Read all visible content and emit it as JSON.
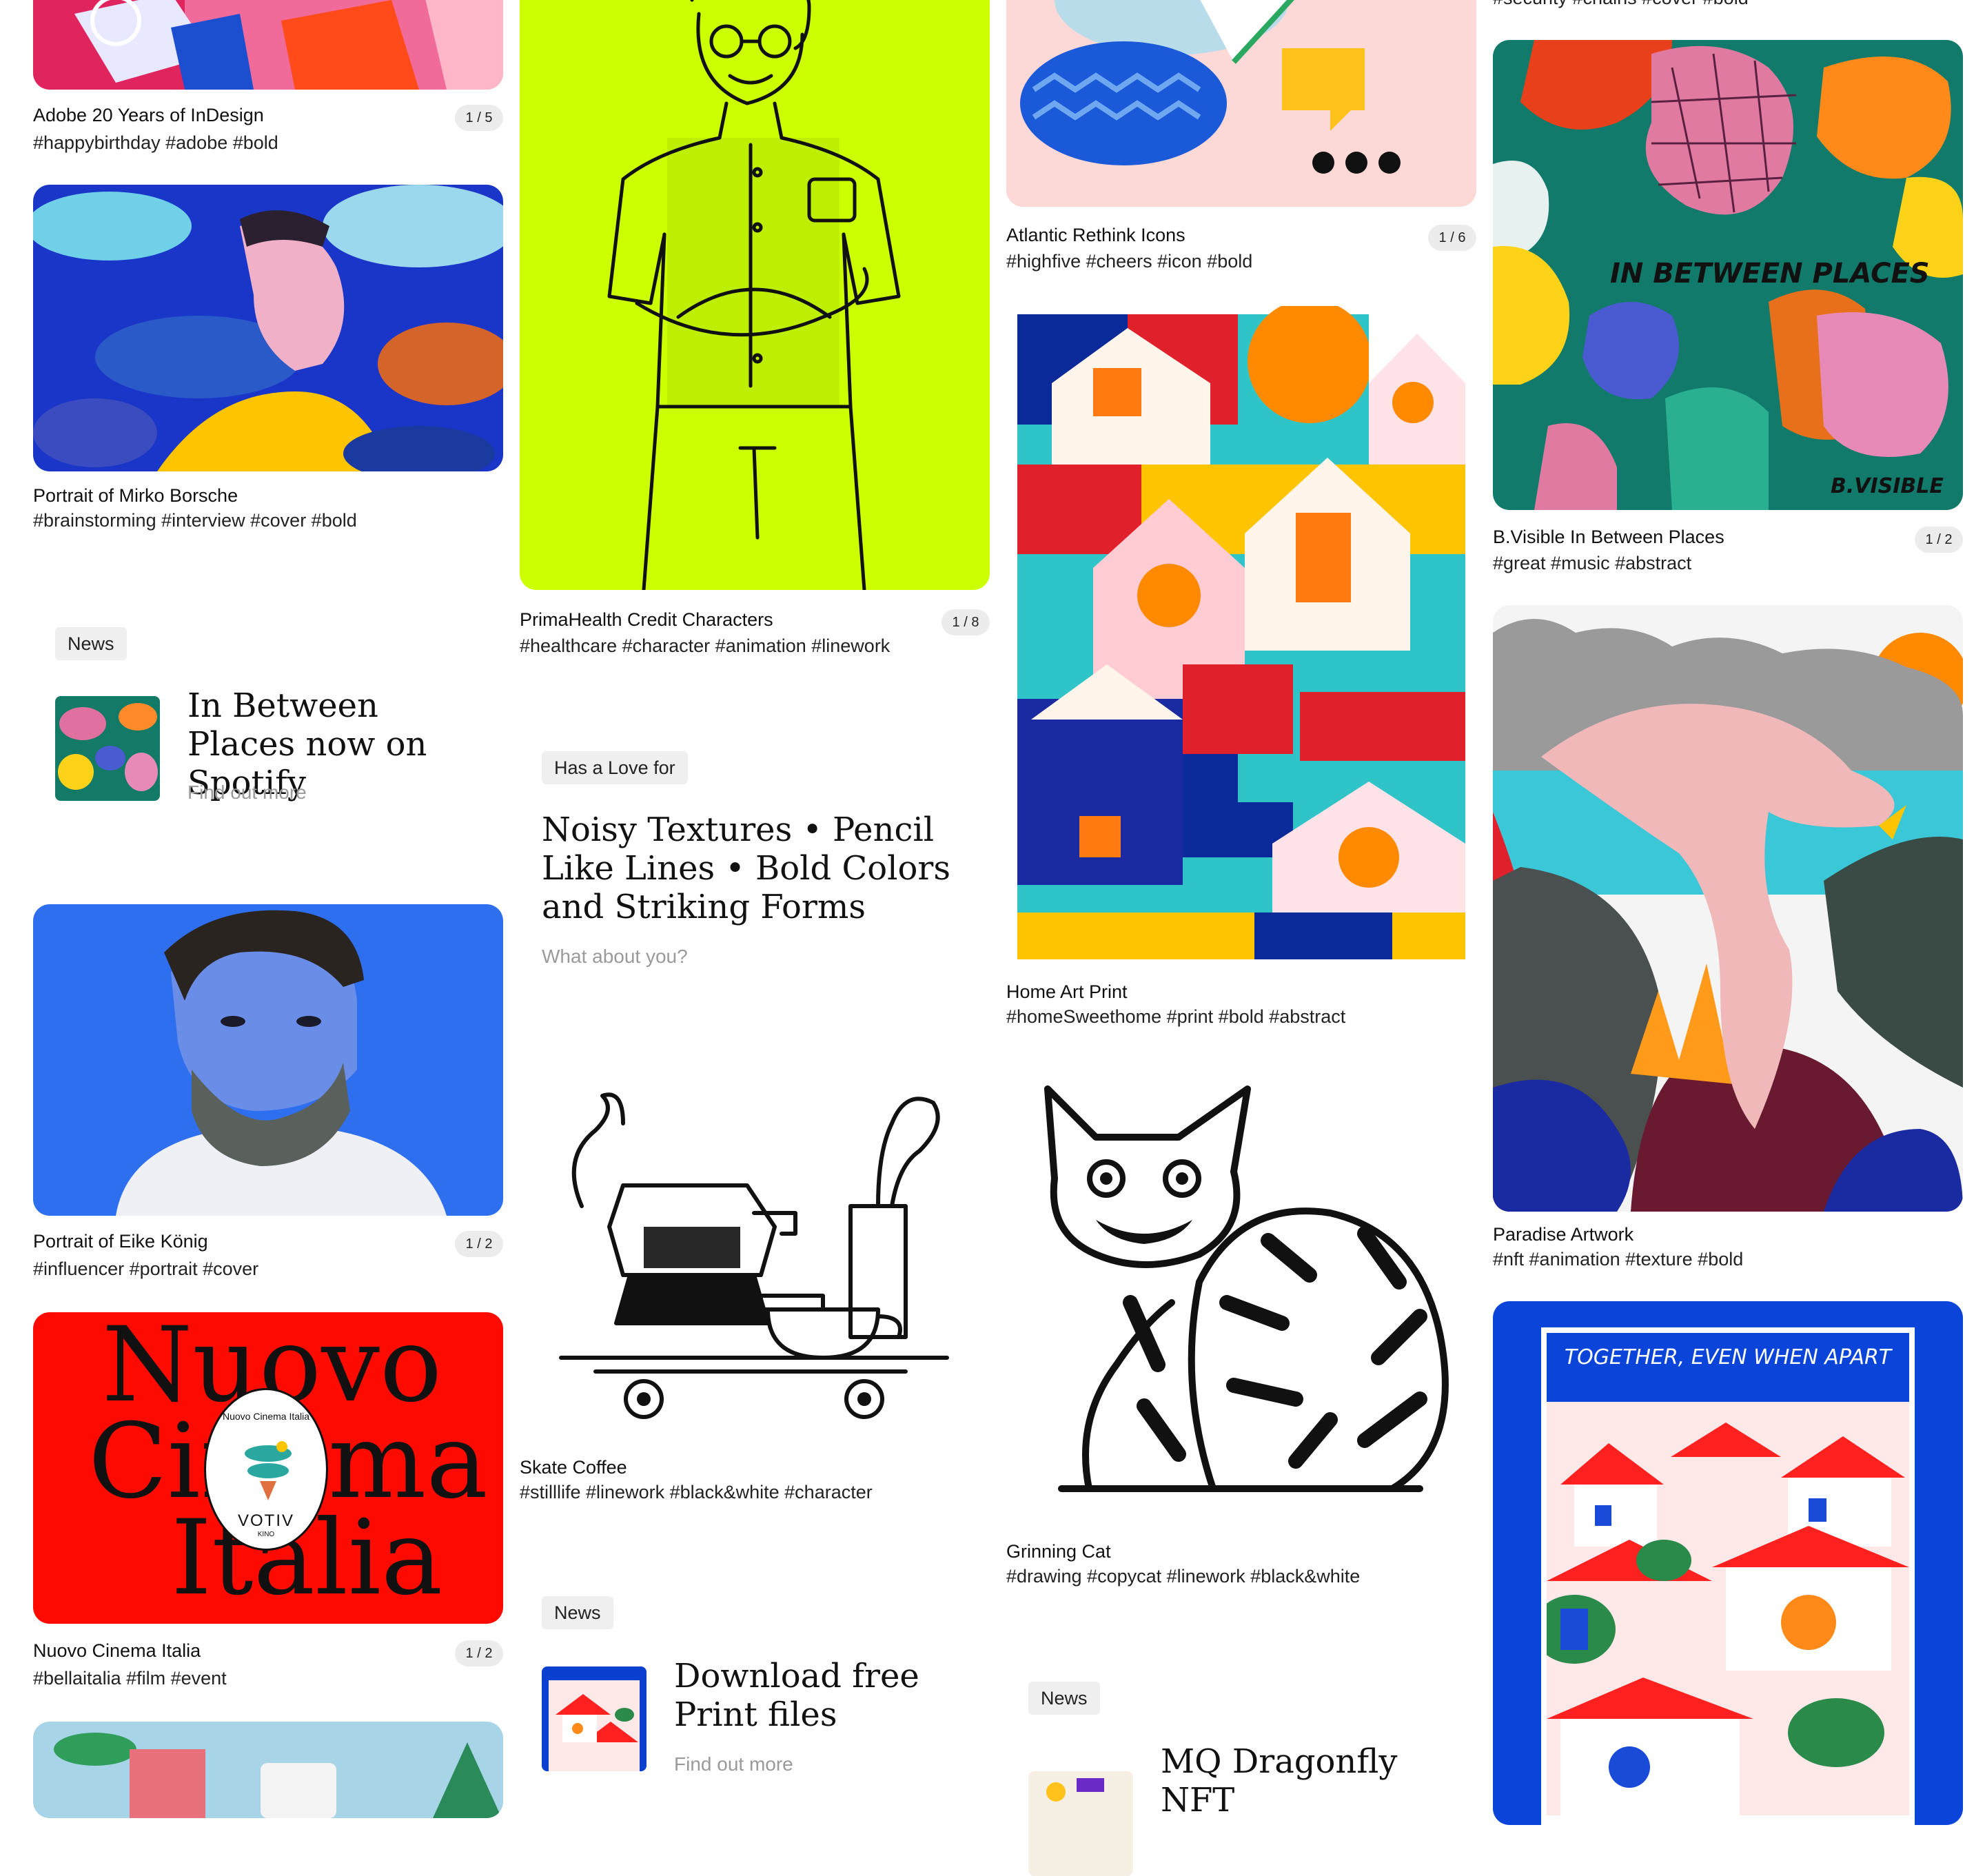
{
  "cards": [
    {
      "title": "Adobe 20 Years of InDesign",
      "tags": "#happybirthday  #adobe  #bold",
      "count": "1 / 5"
    },
    {
      "title": "Portrait of Mirko Borsche",
      "tags": "#brainstorming  #interview  #cover  #bold"
    },
    {
      "title": "Portrait of Eike König",
      "tags": "#influencer  #portrait  #cover",
      "count": "1 / 2"
    },
    {
      "title": "Nuovo Cinema Italia",
      "tags": "#bellaitalia  #film  #event",
      "count": "1 / 2"
    },
    {
      "title": "PrimaHealth Credit Characters",
      "tags": "#healthcare  #character  #animation  #linework",
      "count": "1 / 8"
    },
    {
      "title": "Skate Coffee",
      "tags": "#stilllife  #linework  #black&white  #character"
    },
    {
      "title": "Atlantic Rethink Icons",
      "tags": "#highfive  #cheers  #icon  #bold",
      "count": "1 / 6"
    },
    {
      "title": "Home Art Print",
      "tags": "#homeSweethome  #print  #bold  #abstract"
    },
    {
      "title": "Grinning Cat",
      "tags": "#drawing  #copycat  #linework  #black&white"
    },
    {
      "title": "B.Visible In Between Places",
      "tags": "#great  #music  #abstract",
      "count": "1 / 2"
    },
    {
      "title": "Paradise Artwork",
      "tags": "#nft  #animation  #texture  #bold"
    }
  ],
  "top_partial_tags": "#security  #chains  #cover  #bold",
  "art_text": {
    "nuovo_lines": [
      "Nuovo",
      "Cinema",
      "Italia"
    ],
    "seal_lines": [
      "Nuovo Cinema Italia",
      "VOTIV",
      "KINO"
    ],
    "between_places": "IN BETWEEN PLACES",
    "bvisible": "B.VISIBLE",
    "together": "TOGETHER, EVEN WHEN APART"
  },
  "news": [
    {
      "chip": "News",
      "heading": "In Between Places now on Spotify",
      "link": "Find out more"
    },
    {
      "chip": "News",
      "heading": "Download free Print files",
      "link": "Find out more"
    },
    {
      "chip": "News",
      "heading": "MQ Dragonfly NFT"
    }
  ],
  "love": {
    "chip": "Has a Love for",
    "heading": "Noisy Textures • Pencil Like Lines • Bold Colors and Striking Forms",
    "link": "What about you?"
  }
}
